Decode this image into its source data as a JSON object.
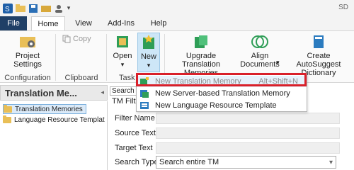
{
  "app": {
    "title_partial": "SD"
  },
  "tabs": [
    {
      "label": "File"
    },
    {
      "label": "Home"
    },
    {
      "label": "View"
    },
    {
      "label": "Add-Ins"
    },
    {
      "label": "Help"
    }
  ],
  "ribbon": {
    "project_settings": "Project\nSettings",
    "copy": "Copy",
    "open": "Open",
    "new": "New",
    "upgrade_tm": "Upgrade Translation\nMemories",
    "align_documents": "Align\nDocuments",
    "create_autosuggest": "Create AutoSuggest\nDictionary",
    "groups": {
      "configuration": "Configuration",
      "clipboard": "Clipboard",
      "tasks_partial": "Task"
    }
  },
  "left_panel": {
    "title": "Translation Me...",
    "tree": [
      {
        "label": "Translation Memories",
        "selected": true
      },
      {
        "label": "Language Resource Templat"
      }
    ]
  },
  "right_panel": {
    "search_partial": "Search D",
    "tm_filter_partial": "TM Filte",
    "fields": [
      {
        "label": "Filter Name"
      },
      {
        "label": "Source Text"
      },
      {
        "label": "Target Text"
      }
    ],
    "search_type_label": "Search Type",
    "search_type_value": "Search entire TM"
  },
  "menu": {
    "items": [
      {
        "label": "New Translation Memory",
        "shortcut": "Alt+Shift+N",
        "disabled": true
      },
      {
        "label": "New Server-based Translation Memory"
      },
      {
        "label": "New Language Resource Template"
      }
    ]
  },
  "colors": {
    "highlight": "#d9202a",
    "file_tab": "#1f3f66",
    "accent": "#2b7bbf"
  }
}
